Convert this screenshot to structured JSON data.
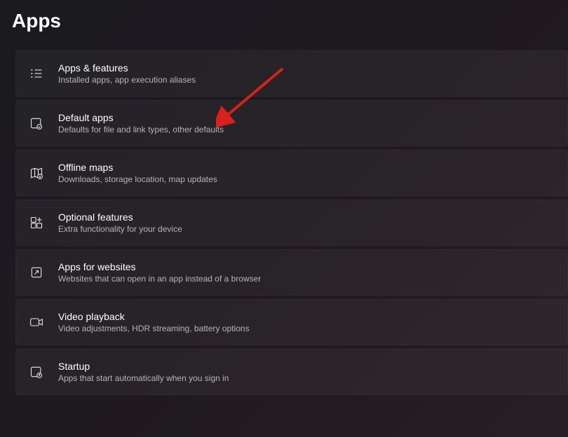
{
  "page": {
    "title": "Apps"
  },
  "items": [
    {
      "title": "Apps & features",
      "desc": "Installed apps, app execution aliases"
    },
    {
      "title": "Default apps",
      "desc": "Defaults for file and link types, other defaults"
    },
    {
      "title": "Offline maps",
      "desc": "Downloads, storage location, map updates"
    },
    {
      "title": "Optional features",
      "desc": "Extra functionality for your device"
    },
    {
      "title": "Apps for websites",
      "desc": "Websites that can open in an app instead of a browser"
    },
    {
      "title": "Video playback",
      "desc": "Video adjustments, HDR streaming, battery options"
    },
    {
      "title": "Startup",
      "desc": "Apps that start automatically when you sign in"
    }
  ]
}
